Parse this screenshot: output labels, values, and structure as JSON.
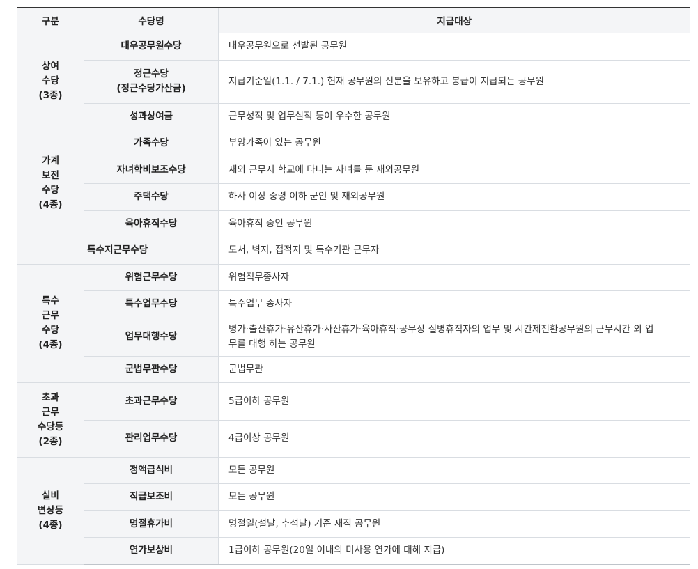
{
  "header": {
    "col1": "구분",
    "col2": "수당명",
    "col3": "지급대상"
  },
  "groups": [
    {
      "label": [
        "상여",
        "수당",
        "(3종)"
      ],
      "rows": [
        {
          "name": [
            "대우공무원수당"
          ],
          "target": [
            "대우공무원으로 선발된 공무원"
          ]
        },
        {
          "name": [
            "정근수당",
            "(정근수당가산금)"
          ],
          "target": [
            "지급기준일(1.1. / 7.1.) 현재 공무원의 신분을 보유하고 봉급이 지급되는 공무원"
          ]
        },
        {
          "name": [
            "성과상여금"
          ],
          "target": [
            "근무성적 및 업무실적 등이 우수한 공무원"
          ]
        }
      ]
    },
    {
      "label": [
        "가계",
        "보전",
        "수당",
        "(4종)"
      ],
      "rows": [
        {
          "name": [
            "가족수당"
          ],
          "target": [
            "부양가족이 있는 공무원"
          ]
        },
        {
          "name": [
            "자녀학비보조수당"
          ],
          "target": [
            "재외 근무지 학교에 다니는 자녀를 둔 재외공무원"
          ]
        },
        {
          "name": [
            "주택수당"
          ],
          "target": [
            "하사 이상 중령 이하 군인 및 재외공무원"
          ]
        },
        {
          "name": [
            "육아휴직수당"
          ],
          "target": [
            "육아휴직 중인 공무원"
          ]
        }
      ]
    },
    {
      "merged": true,
      "rows": [
        {
          "name": [
            "특수지근무수당"
          ],
          "target": [
            "도서, 벽지, 접적지 및 특수기관 근무자"
          ]
        }
      ]
    },
    {
      "label": [
        "특수",
        "근무",
        "수당",
        "(4종)"
      ],
      "rows": [
        {
          "name": [
            "위험근무수당"
          ],
          "target": [
            "위험직무종사자"
          ]
        },
        {
          "name": [
            "특수업무수당"
          ],
          "target": [
            "특수업무 종사자"
          ]
        },
        {
          "name": [
            "업무대행수당"
          ],
          "target": [
            "병가·출산휴가·유산휴가·사산휴가·육아휴직·공무상 질병휴직자의 업무 및 시간제전환공무원의 근무시간 외 업",
            "무를 대행 하는 공무원"
          ]
        },
        {
          "name": [
            "군법무관수당"
          ],
          "target": [
            "군법무관"
          ]
        }
      ]
    },
    {
      "label": [
        "초과",
        "근무",
        "수당등",
        "(2종)"
      ],
      "rows": [
        {
          "name": [
            "초과근무수당"
          ],
          "target": [
            "5급이하 공무원"
          ]
        },
        {
          "name": [
            "관리업무수당"
          ],
          "target": [
            "4급이상 공무원"
          ]
        }
      ]
    },
    {
      "label": [
        "실비",
        "변상등",
        "(4종)"
      ],
      "rows": [
        {
          "name": [
            "정액급식비"
          ],
          "target": [
            "모든 공무원"
          ]
        },
        {
          "name": [
            "직급보조비"
          ],
          "target": [
            "모든 공무원"
          ]
        },
        {
          "name": [
            "명절휴가비"
          ],
          "target": [
            "명절일(설날, 추석날) 기준 재직 공무원"
          ]
        },
        {
          "name": [
            "연가보상비"
          ],
          "target": [
            "1급이하 공무원(20일 이내의 미사용 연가에 대해 지급)"
          ]
        }
      ]
    }
  ]
}
